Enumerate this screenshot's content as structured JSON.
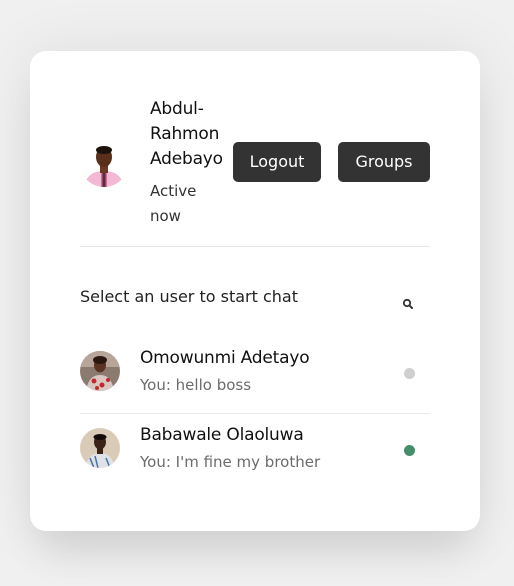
{
  "current_user": {
    "name": "Abdul-Rahmon Adebayo",
    "status": "Active now",
    "avatar_icon": "user-photo-icon"
  },
  "header": {
    "logout_label": "Logout",
    "groups_label": "Groups"
  },
  "search": {
    "prompt": "Select an user to start chat",
    "icon": "search-icon"
  },
  "users": [
    {
      "name": "Omowunmi Adetayo",
      "last_message": "You: hello boss",
      "online": false,
      "status_color": "#cfcfcf"
    },
    {
      "name": "Babawale Olaoluwa",
      "last_message": "You: I'm fine my brother",
      "online": true,
      "status_color": "#468e6a"
    }
  ],
  "colors": {
    "button_bg": "#333333",
    "button_text": "#ffffff",
    "page_bg": "#f0f0f0"
  }
}
